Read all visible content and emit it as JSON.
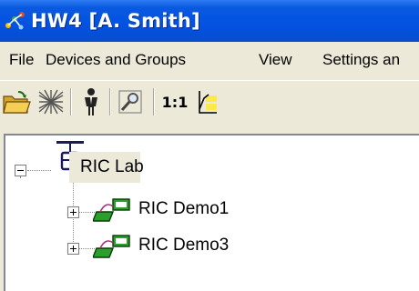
{
  "window": {
    "title": "HW4 [A. Smith]"
  },
  "menu": [
    "File",
    "Devices and Groups",
    "View",
    "Settings an"
  ],
  "toolbar": {
    "buttons": [
      {
        "name": "open-folder-icon"
      },
      {
        "name": "network-grid-icon"
      },
      {
        "name": "person-icon"
      },
      {
        "name": "search-tool-icon"
      },
      {
        "name": "one-to-one-icon",
        "label": "1:1"
      },
      {
        "name": "chart-icon"
      }
    ]
  },
  "tree": {
    "root": {
      "label": "RIC Lab",
      "expanded": true
    },
    "children": [
      {
        "label": "RIC Demo1",
        "expanded": false
      },
      {
        "label": "RIC Demo3",
        "expanded": false
      }
    ]
  }
}
